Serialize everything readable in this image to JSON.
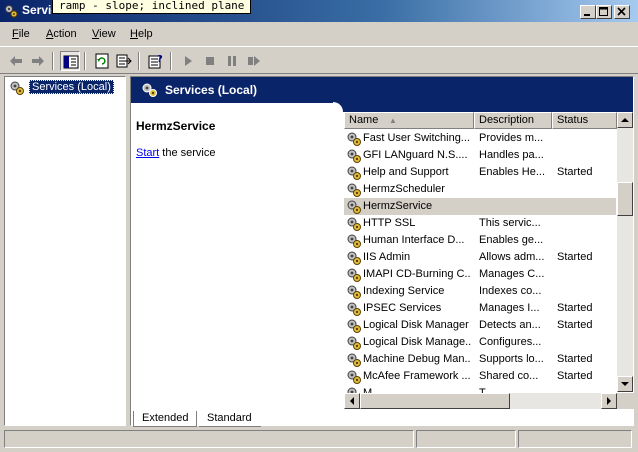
{
  "window": {
    "title": "Services"
  },
  "tooltip": "ramp - slope; inclined plane",
  "menu": [
    {
      "label": "File"
    },
    {
      "label": "Action"
    },
    {
      "label": "View"
    },
    {
      "label": "Help"
    }
  ],
  "toolbar": {
    "icons": [
      "back-arrow-icon",
      "forward-arrow-icon",
      "show-hide-tree-icon",
      "refresh-icon",
      "export-list-icon",
      "properties-help-icon",
      "start-service-icon",
      "stop-service-icon",
      "pause-service-icon",
      "restart-service-icon"
    ]
  },
  "tree": {
    "root_label": "Services (Local)"
  },
  "header": {
    "title": "Services (Local)"
  },
  "detail": {
    "selected_service": "HermzService",
    "start_link": "Start",
    "start_suffix": " the service"
  },
  "list": {
    "columns": [
      "Name",
      "Description",
      "Status"
    ],
    "sort_indicator": "▲",
    "rows": [
      {
        "name": "Fast User Switching...",
        "description": "Provides m...",
        "status": ""
      },
      {
        "name": "GFI LANguard N.S....",
        "description": "Handles pa...",
        "status": ""
      },
      {
        "name": "Help and Support",
        "description": "Enables He...",
        "status": "Started"
      },
      {
        "name": "HermzScheduler",
        "description": "",
        "status": ""
      },
      {
        "name": "HermzService",
        "description": "",
        "status": ""
      },
      {
        "name": "HTTP SSL",
        "description": "This servic...",
        "status": ""
      },
      {
        "name": "Human Interface D...",
        "description": "Enables ge...",
        "status": ""
      },
      {
        "name": "IIS Admin",
        "description": "Allows adm...",
        "status": "Started"
      },
      {
        "name": "IMAPI CD-Burning C...",
        "description": "Manages C...",
        "status": ""
      },
      {
        "name": "Indexing Service",
        "description": "Indexes co...",
        "status": ""
      },
      {
        "name": "IPSEC Services",
        "description": "Manages I...",
        "status": "Started"
      },
      {
        "name": "Logical Disk Manager",
        "description": "Detects an...",
        "status": "Started"
      },
      {
        "name": "Logical Disk Manage...",
        "description": "Configures...",
        "status": ""
      },
      {
        "name": "Machine Debug Man...",
        "description": "Supports lo...",
        "status": "Started"
      },
      {
        "name": "McAfee Framework ...",
        "description": "Shared co...",
        "status": "Started"
      },
      {
        "name": "M...",
        "description": "T...",
        "status": ""
      }
    ],
    "selected_index": 4
  },
  "tabs": [
    {
      "label": "Extended",
      "active": true
    },
    {
      "label": "Standard",
      "active": false
    }
  ],
  "colors": {
    "title_bar": "#0a246a",
    "selection": "#0a246a",
    "face": "#d4d0c8"
  }
}
